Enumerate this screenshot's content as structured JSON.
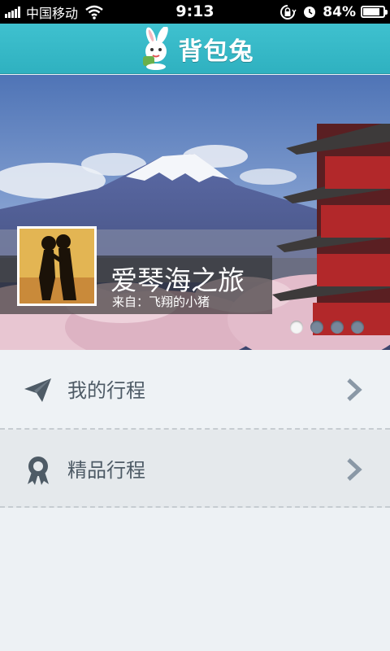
{
  "status_bar": {
    "carrier": "中国移动",
    "time": "9:13",
    "battery_percent": "84%",
    "battery_level": 0.84,
    "icons": [
      "signal-icon",
      "wifi-icon",
      "rotation-lock-icon",
      "alarm-icon",
      "battery-icon"
    ]
  },
  "header": {
    "logo_text": "背包兔",
    "logo_icon": "rabbit-mascot-icon"
  },
  "banner": {
    "trip_title": "爱琴海之旅",
    "from_text": "来自：飞翔的小猪",
    "slide_count": 4,
    "active_slide": 1
  },
  "menu": {
    "items": [
      {
        "label": "我的行程",
        "icon": "paper-plane-icon",
        "chevron": "chevron-right-icon"
      },
      {
        "label": "精品行程",
        "icon": "award-ribbon-icon",
        "chevron": "chevron-right-icon"
      }
    ]
  },
  "colors": {
    "header": "#33b6c5",
    "status_bar": "#000000",
    "background": "#edf1f4",
    "menu_text": "#4e5b66",
    "dot_inactive": "#77879a",
    "dot_active": "#f5f5f5"
  }
}
